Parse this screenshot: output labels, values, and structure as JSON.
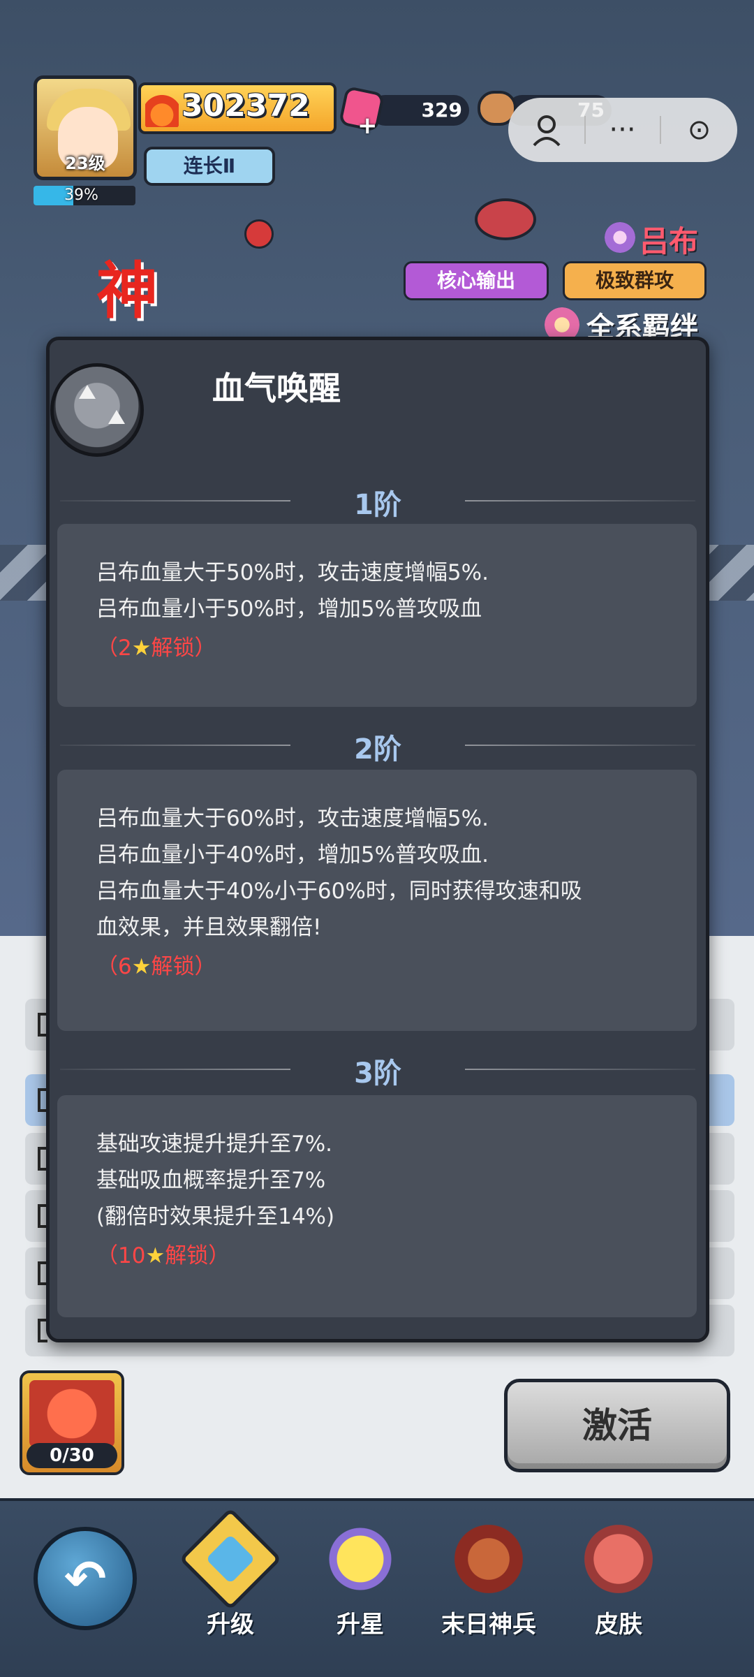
{
  "hud": {
    "avatar_level": "23级",
    "exp_percent_text": "39%",
    "exp_fraction": 0.39,
    "power": "302372",
    "rank": "连长Ⅱ",
    "gems": "329",
    "wood": "75",
    "capsule_icons": [
      "gamepad-icon",
      "more-icon",
      "record-icon"
    ],
    "capsule_more": "···",
    "capsule_record": "⊙"
  },
  "hero": {
    "name": "吕布",
    "tags": [
      "核心输出",
      "极致群攻"
    ],
    "bond": "全系羁绊",
    "banner_text": "神"
  },
  "skill": {
    "title": "血气唤醒",
    "tiers": [
      {
        "label": "1阶",
        "lines": [
          "吕布血量大于50%时，攻击速度增幅5%.",
          "吕布血量小于50%时，增加5%普攻吸血"
        ],
        "unlock_pre": "（2",
        "unlock_star": "★",
        "unlock_post": "解锁）"
      },
      {
        "label": "2阶",
        "lines": [
          "吕布血量大于60%时，攻击速度增幅5%.",
          "吕布血量小于40%时，增加5%普攻吸血.",
          "吕布血量大于40%小于60%时，同时获得攻速和吸",
          "血效果，并且效果翻倍!"
        ],
        "unlock_pre": "（6",
        "unlock_star": "★",
        "unlock_post": "解锁）"
      },
      {
        "label": "3阶",
        "lines": [
          "基础攻速提升提升至7%.",
          "基础吸血概率提升至7%",
          "(翻倍时效果提升至14%)"
        ],
        "unlock_pre": "（10",
        "unlock_star": "★",
        "unlock_post": "解锁）"
      }
    ]
  },
  "actions": {
    "fragments": "0/30",
    "activate": "激活"
  },
  "nav": {
    "back_glyph": "↶",
    "items": [
      {
        "label": "升级"
      },
      {
        "label": "升星"
      },
      {
        "label": "末日神兵"
      },
      {
        "label": "皮肤"
      }
    ]
  },
  "colors": {
    "unlock_red": "#ff4646",
    "tier_label_blue": "#a8c8ee",
    "tag_purple": "#b35ad6",
    "tag_orange": "#f5b04d",
    "hero_name_red": "#ff5a6e"
  }
}
